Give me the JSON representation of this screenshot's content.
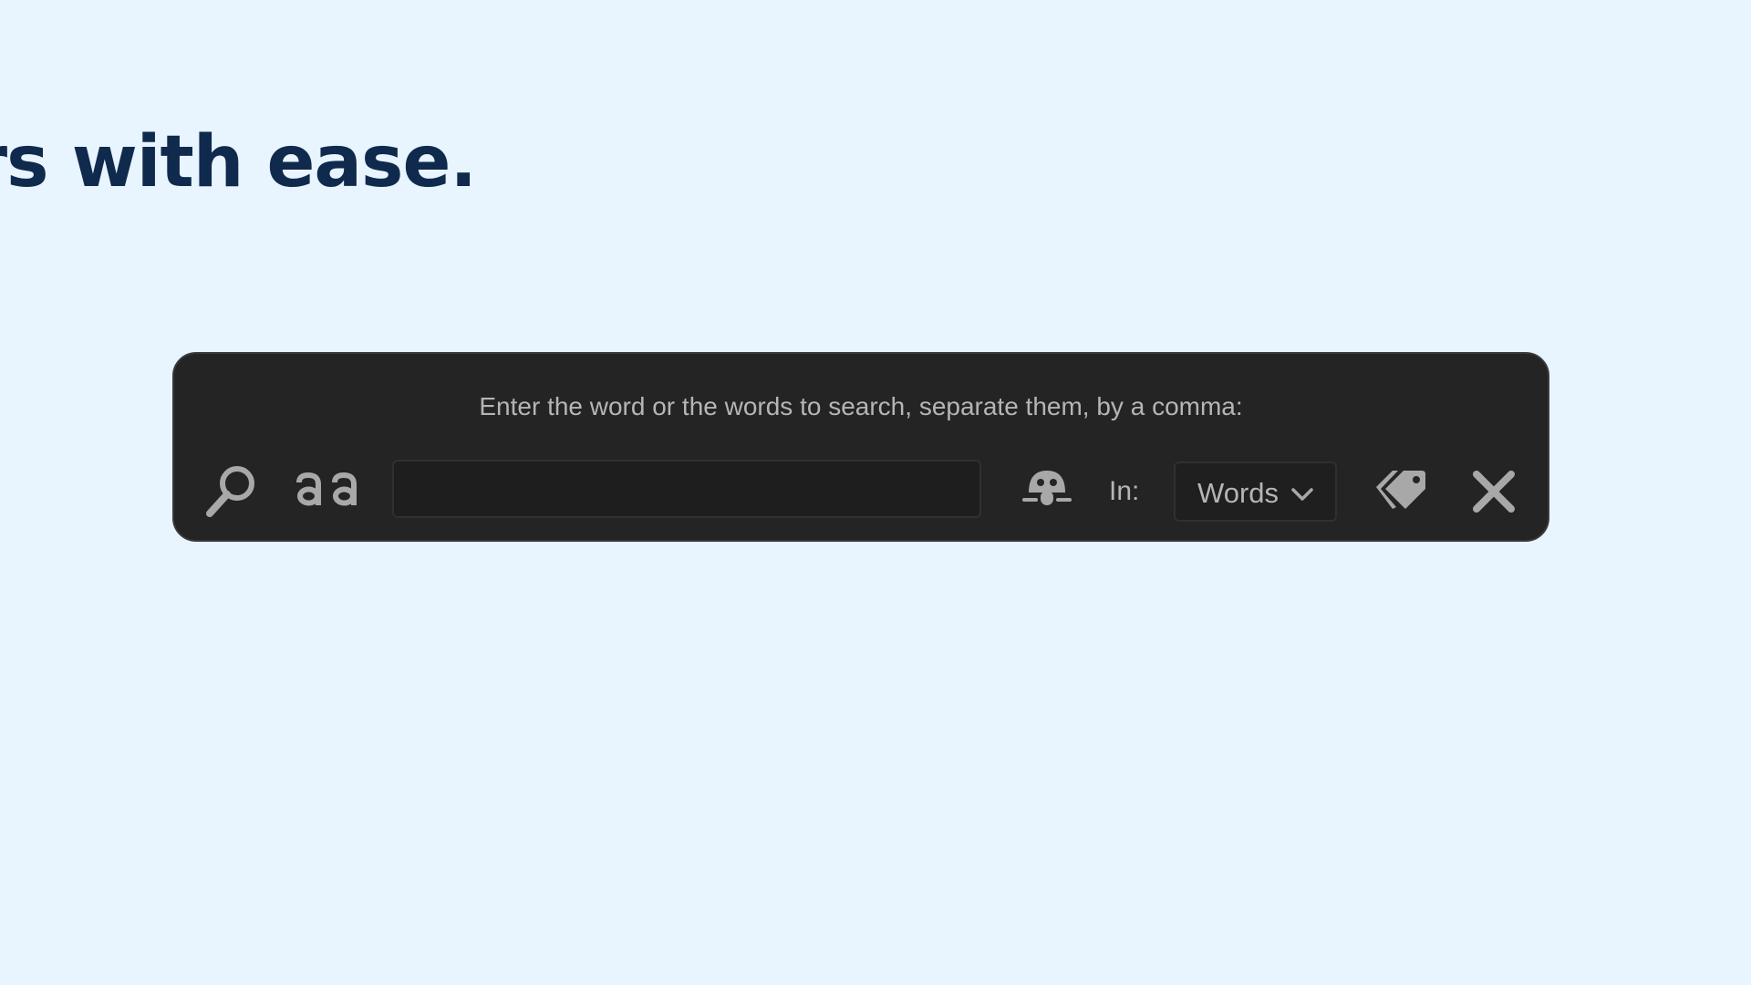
{
  "page": {
    "headline": "yers with ease."
  },
  "search_panel": {
    "prompt": "Enter the word or the words to search, separate them, by a comma:",
    "input_value": "",
    "input_placeholder": "",
    "in_label": "In:",
    "scope_select": {
      "selected": "Words"
    }
  },
  "icons": {
    "search": "search-icon",
    "match_case": "match-case-icon",
    "wildcard": "ghost-icon",
    "dropdown": "chevron-down-icon",
    "tags": "tags-icon",
    "close": "close-icon"
  },
  "colors": {
    "background": "#e8f4fe",
    "headline": "#0f2a4d",
    "panel": "#242424",
    "icon": "#a8a8a8"
  }
}
